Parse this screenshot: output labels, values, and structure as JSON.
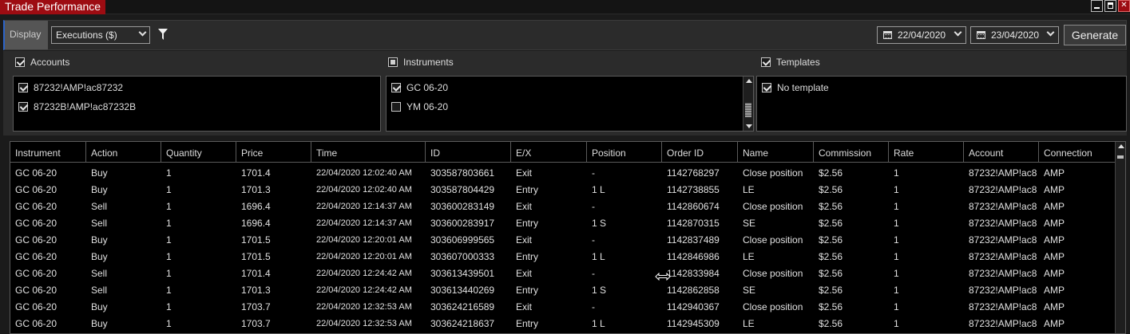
{
  "window": {
    "title": "Trade Performance"
  },
  "toolbar": {
    "display_label": "Display",
    "display_value": "Executions ($)",
    "start_date": "22/04/2020",
    "end_date": "23/04/2020",
    "generate_label": "Generate"
  },
  "filters": {
    "accounts": {
      "label": "Accounts",
      "checked": true,
      "items": [
        {
          "label": "87232!AMP!ac87232",
          "checked": true
        },
        {
          "label": "87232B!AMP!ac87232B",
          "checked": true
        }
      ]
    },
    "instruments": {
      "label": "Instruments",
      "state": "partial",
      "items": [
        {
          "label": "GC 06-20",
          "checked": true
        },
        {
          "label": "YM 06-20",
          "checked": false
        }
      ]
    },
    "templates": {
      "label": "Templates",
      "checked": true,
      "items": [
        {
          "label": "No template",
          "checked": true
        }
      ]
    }
  },
  "grid": {
    "columns": [
      "Instrument",
      "Action",
      "Quantity",
      "Price",
      "Time",
      "ID",
      "E/X",
      "Position",
      "Order ID",
      "Name",
      "Commission",
      "Rate",
      "Account",
      "Connection"
    ],
    "rows": [
      [
        "GC 06-20",
        "Buy",
        "1",
        "1701.4",
        "22/04/2020 12:02:40 AM",
        "303587803661",
        "Exit",
        "-",
        "1142768297",
        "Close position",
        "$2.56",
        "1",
        "87232!AMP!ac8",
        "AMP"
      ],
      [
        "GC 06-20",
        "Buy",
        "1",
        "1701.3",
        "22/04/2020 12:02:40 AM",
        "303587804429",
        "Entry",
        "1 L",
        "1142738855",
        "LE",
        "$2.56",
        "1",
        "87232!AMP!ac8",
        "AMP"
      ],
      [
        "GC 06-20",
        "Sell",
        "1",
        "1696.4",
        "22/04/2020 12:14:37 AM",
        "303600283149",
        "Exit",
        "-",
        "1142860674",
        "Close position",
        "$2.56",
        "1",
        "87232!AMP!ac8",
        "AMP"
      ],
      [
        "GC 06-20",
        "Sell",
        "1",
        "1696.4",
        "22/04/2020 12:14:37 AM",
        "303600283917",
        "Entry",
        "1 S",
        "1142870315",
        "SE",
        "$2.56",
        "1",
        "87232!AMP!ac8",
        "AMP"
      ],
      [
        "GC 06-20",
        "Buy",
        "1",
        "1701.5",
        "22/04/2020 12:20:01 AM",
        "303606999565",
        "Exit",
        "-",
        "1142837489",
        "Close position",
        "$2.56",
        "1",
        "87232!AMP!ac8",
        "AMP"
      ],
      [
        "GC 06-20",
        "Buy",
        "1",
        "1701.5",
        "22/04/2020 12:20:01 AM",
        "303607000333",
        "Entry",
        "1 L",
        "1142846986",
        "LE",
        "$2.56",
        "1",
        "87232!AMP!ac8",
        "AMP"
      ],
      [
        "GC 06-20",
        "Sell",
        "1",
        "1701.4",
        "22/04/2020 12:24:42 AM",
        "303613439501",
        "Exit",
        "-",
        "1142833984",
        "Close position",
        "$2.56",
        "1",
        "87232!AMP!ac8",
        "AMP"
      ],
      [
        "GC 06-20",
        "Sell",
        "1",
        "1701.3",
        "22/04/2020 12:24:42 AM",
        "303613440269",
        "Entry",
        "1 S",
        "1142862858",
        "SE",
        "$2.56",
        "1",
        "87232!AMP!ac8",
        "AMP"
      ],
      [
        "GC 06-20",
        "Buy",
        "1",
        "1703.7",
        "22/04/2020 12:32:53 AM",
        "303624216589",
        "Exit",
        "-",
        "1142940367",
        "Close position",
        "$2.56",
        "1",
        "87232!AMP!ac8",
        "AMP"
      ],
      [
        "GC 06-20",
        "Buy",
        "1",
        "1703.7",
        "22/04/2020 12:32:53 AM",
        "303624218637",
        "Entry",
        "1 L",
        "1142945309",
        "LE",
        "$2.56",
        "1",
        "87232!AMP!ac8",
        "AMP"
      ]
    ]
  }
}
